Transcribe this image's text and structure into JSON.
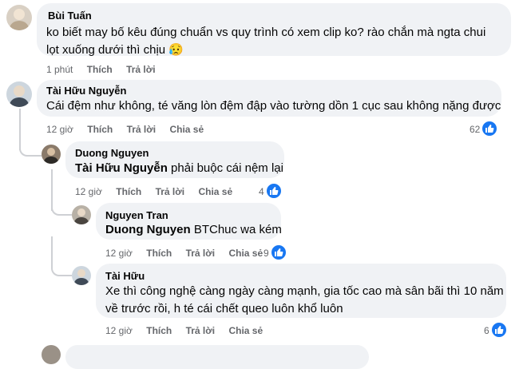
{
  "comments": [
    {
      "author": "Bùi Tuấn",
      "text": "ko biết may bố kêu đúng chuẩn vs quy trình có xem clip ko? rào chắn mà ngta chui lọt xuống dưới thì chịu",
      "emoji": "😥",
      "time": "1 phút",
      "like_label": "Thích",
      "reply_label": "Trả lời"
    },
    {
      "author": "Tài Hữu Nguyễn",
      "text": "Cái đệm như không, té văng lòn đệm đập vào tường dồn 1 cục sau không nặng được",
      "time": "12 giờ",
      "like_label": "Thích",
      "reply_label": "Trả lời",
      "share_label": "Chia sẻ",
      "reactions": "62"
    },
    {
      "author": "Duong Nguyen",
      "mention": "Tài Hữu Nguyễn",
      "text": " phải buộc cái nệm lại",
      "time": "12 giờ",
      "like_label": "Thích",
      "reply_label": "Trả lời",
      "share_label": "Chia sẻ",
      "reactions": "4"
    },
    {
      "author": "Nguyen Tran",
      "mention": "Duong Nguyen",
      "text": " BTChuc wa kém",
      "time": "12 giờ",
      "like_label": "Thích",
      "reply_label": "Trả lời",
      "share_label": "Chia sẻ",
      "reactions": "9"
    },
    {
      "author": "Tài Hữu",
      "text_line1": "Xe thì công nghệ càng ngày càng mạnh, gia tốc cao mà sân bãi thì 10 năm",
      "text_line2": "về trước rồi, h té cái chết queo luôn khổ luôn",
      "time": "12 giờ",
      "like_label": "Thích",
      "reply_label": "Trả lời",
      "share_label": "Chia sẻ",
      "reactions": "6"
    }
  ]
}
